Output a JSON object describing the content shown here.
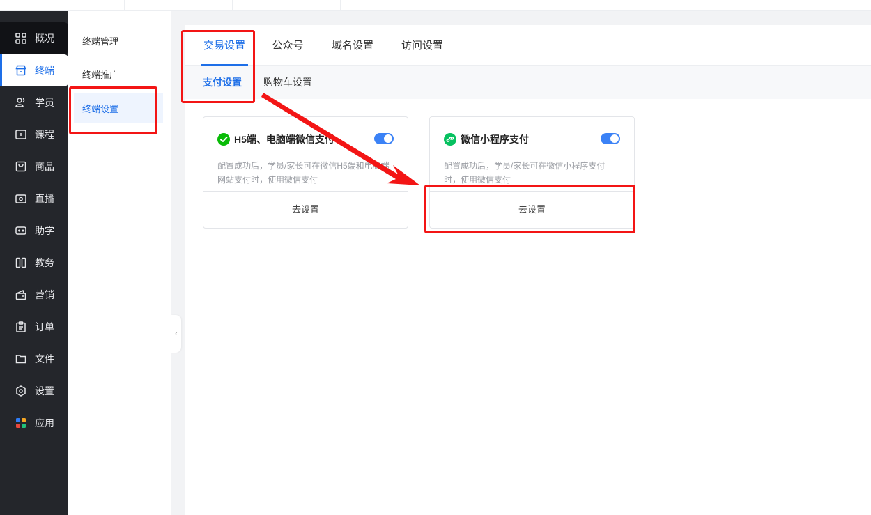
{
  "sidebar": {
    "items": [
      {
        "label": "概况",
        "icon": "grid-icon"
      },
      {
        "label": "终端",
        "icon": "store-icon"
      },
      {
        "label": "学员",
        "icon": "users-icon"
      },
      {
        "label": "课程",
        "icon": "course-icon"
      },
      {
        "label": "商品",
        "icon": "goods-icon"
      },
      {
        "label": "直播",
        "icon": "live-icon"
      },
      {
        "label": "助学",
        "icon": "gamepad-icon"
      },
      {
        "label": "教务",
        "icon": "columns-icon"
      },
      {
        "label": "营销",
        "icon": "wallet-icon"
      },
      {
        "label": "订单",
        "icon": "clipboard-icon"
      },
      {
        "label": "文件",
        "icon": "folder-icon"
      },
      {
        "label": "设置",
        "icon": "hexagon-icon"
      },
      {
        "label": "应用",
        "icon": "apps-icon"
      }
    ]
  },
  "submenu": {
    "items": [
      {
        "label": "终端管理"
      },
      {
        "label": "终端推广"
      },
      {
        "label": "终端设置"
      }
    ]
  },
  "tabs": [
    {
      "label": "交易设置"
    },
    {
      "label": "公众号"
    },
    {
      "label": "域名设置"
    },
    {
      "label": "访问设置"
    }
  ],
  "subtabs": [
    {
      "label": "支付设置"
    },
    {
      "label": "购物车设置"
    }
  ],
  "cards": [
    {
      "title": "H5端、电脑端微信支付",
      "description": "配置成功后，学员/家长可在微信H5端和电脑端网站支付时，使用微信支付",
      "action": "去设置",
      "enabled": true,
      "icon": "wechat-icon"
    },
    {
      "title": "微信小程序支付",
      "description": "配置成功后，学员/家长可在微信小程序支付时，使用微信支付",
      "action": "去设置",
      "enabled": true,
      "icon": "miniprogram-icon"
    }
  ],
  "colors": {
    "accent": "#1e6fe8",
    "sidebar_bg": "#24262b",
    "annotation_red": "#f31515",
    "toggle_on": "#3b82f6",
    "wechat_green": "#09bb07"
  }
}
